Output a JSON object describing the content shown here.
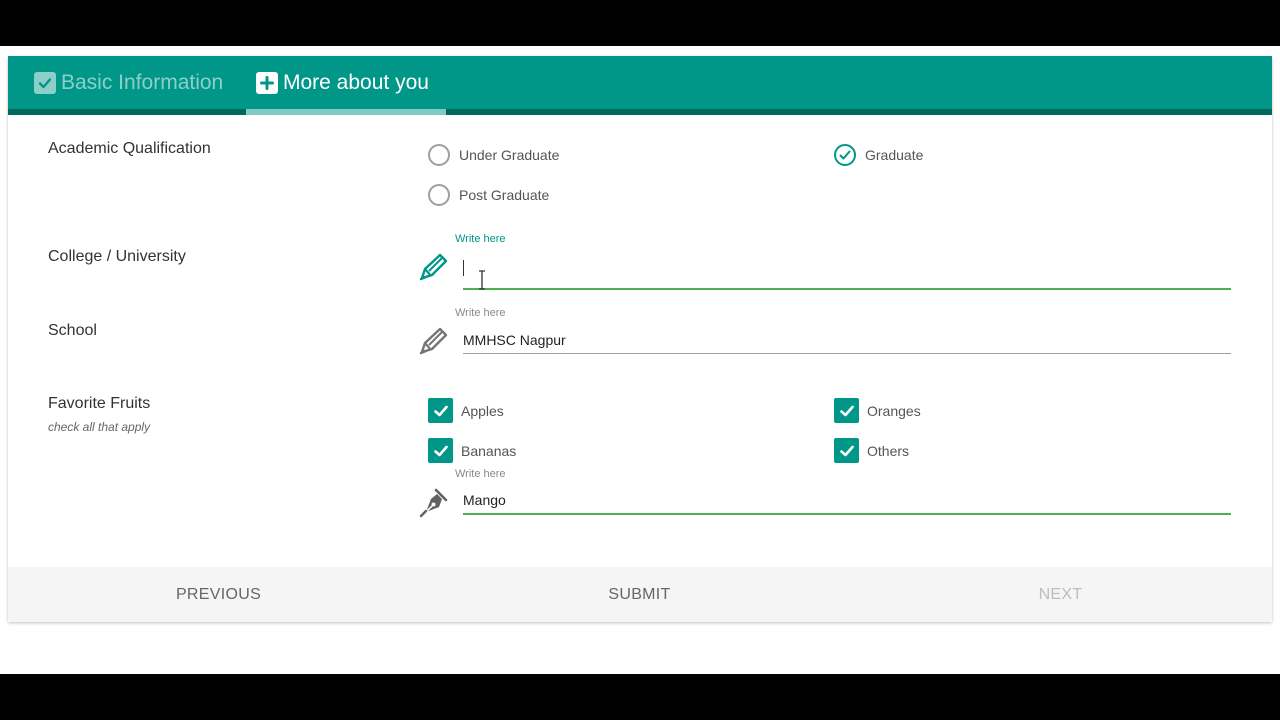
{
  "tabs": [
    {
      "label": "Basic Information",
      "icon": "checkbox-check-icon",
      "active": false
    },
    {
      "label": "More about you",
      "icon": "plus-box-icon",
      "active": true
    }
  ],
  "academic": {
    "label": "Academic Qualification",
    "options": [
      {
        "label": "Under Graduate",
        "checked": false
      },
      {
        "label": "Graduate",
        "checked": true
      },
      {
        "label": "Post Graduate",
        "checked": false
      }
    ]
  },
  "college": {
    "label": "College / University",
    "hint": "Write here",
    "value": "",
    "icon": "pencil-icon"
  },
  "school": {
    "label": "School",
    "hint": "Write here",
    "value": "MMHSC Nagpur",
    "icon": "pencil-icon"
  },
  "fruits": {
    "label": "Favorite Fruits",
    "sublabel": "check all that apply",
    "options": [
      {
        "label": "Apples",
        "checked": true
      },
      {
        "label": "Oranges",
        "checked": true
      },
      {
        "label": "Bananas",
        "checked": true
      },
      {
        "label": "Others",
        "checked": true
      }
    ],
    "other": {
      "hint": "Write here",
      "value": "Mango",
      "icon": "pen-nib-icon"
    }
  },
  "footer": {
    "previous": "PREVIOUS",
    "submit": "SUBMIT",
    "next": "NEXT"
  },
  "colors": {
    "primary": "#009688",
    "primary_dark": "#00695c",
    "indicator": "#80cbc4",
    "focus_line": "#4caf50"
  }
}
